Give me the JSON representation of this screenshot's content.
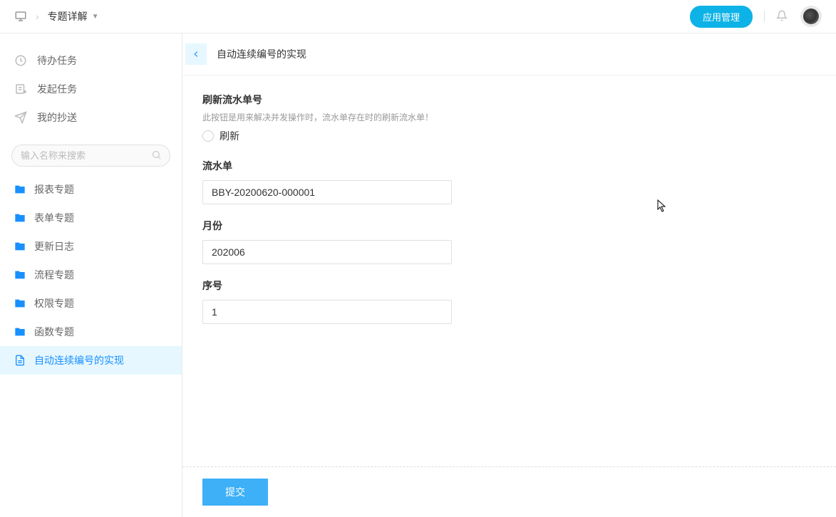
{
  "header": {
    "breadcrumb_title": "专题详解",
    "app_manage": "应用管理"
  },
  "sidebar": {
    "nav": {
      "todo": "待办任务",
      "start": "发起任务",
      "cc": "我的抄送"
    },
    "search_placeholder": "输入名称来搜索",
    "folders": [
      {
        "label": "报表专题",
        "type": "folder"
      },
      {
        "label": "表单专题",
        "type": "folder"
      },
      {
        "label": "更新日志",
        "type": "folder"
      },
      {
        "label": "流程专题",
        "type": "folder"
      },
      {
        "label": "权限专题",
        "type": "folder"
      },
      {
        "label": "函数专题",
        "type": "folder"
      },
      {
        "label": "自动连续编号的实现",
        "type": "file",
        "active": true
      }
    ]
  },
  "content": {
    "title": "自动连续编号的实现",
    "refresh_section": {
      "title": "刷新流水单号",
      "hint": "此按钮是用来解决并发操作时，流水单存在时的刷新流水单！",
      "radio_label": "刷新"
    },
    "fields": {
      "serial_label": "流水单",
      "serial_value": "BBY-20200620-000001",
      "month_label": "月份",
      "month_value": "202006",
      "seq_label": "序号",
      "seq_value": "1"
    },
    "submit": "提交"
  }
}
